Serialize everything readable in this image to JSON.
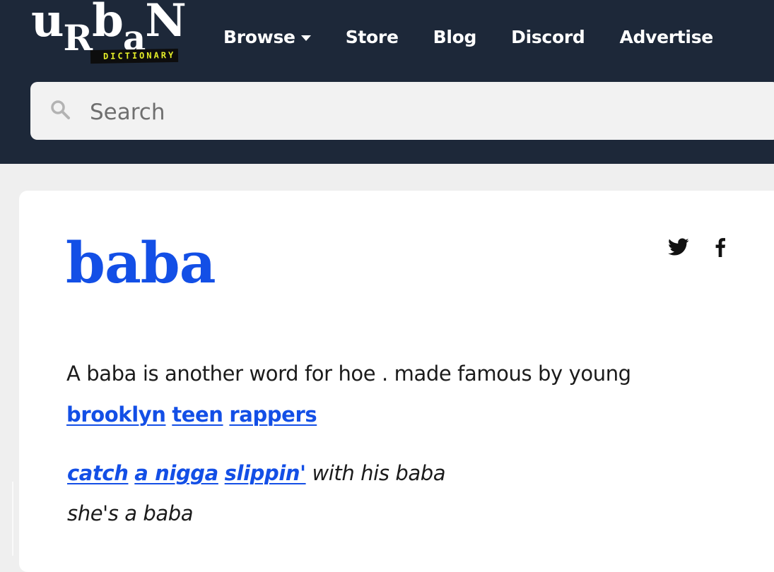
{
  "header": {
    "logo": {
      "word": "urban",
      "tagline": "DICTIONARY"
    },
    "nav": [
      {
        "label": "Browse",
        "has_dropdown": true
      },
      {
        "label": "Store"
      },
      {
        "label": "Blog"
      },
      {
        "label": "Discord"
      },
      {
        "label": "Advertise"
      }
    ],
    "search": {
      "placeholder": "Search",
      "icon": "search-icon"
    }
  },
  "entry": {
    "word": "baba",
    "share_icons": [
      "twitter-icon",
      "facebook-icon"
    ],
    "meaning": {
      "text": "A baba is another word for hoe . made famous by young",
      "links": [
        "brooklyn",
        "teen",
        "rappers"
      ]
    },
    "example": {
      "links": [
        "catch",
        "a nigga",
        "slippin'"
      ],
      "line1_rest": "with his baba",
      "line2": "she's a baba"
    }
  },
  "colors": {
    "header_bg": "#1d2839",
    "accent_blue": "#134fe6",
    "page_bg": "#efefef",
    "logo_tag_text": "#e6f028"
  }
}
